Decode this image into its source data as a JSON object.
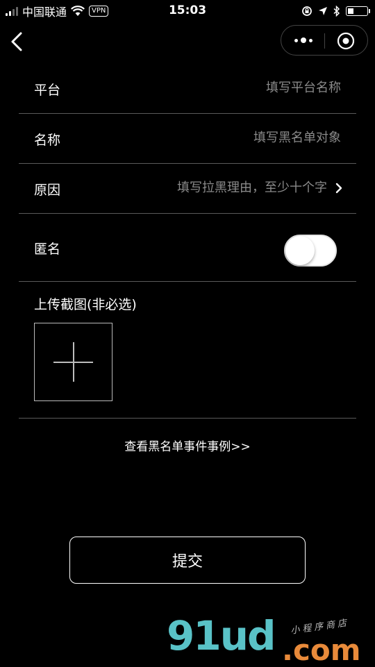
{
  "status_bar": {
    "carrier": "中国联通",
    "vpn": "VPN",
    "time": "15:03"
  },
  "form": {
    "platform": {
      "label": "平台",
      "placeholder": "填写平台名称"
    },
    "name": {
      "label": "名称",
      "placeholder": "填写黑名单对象"
    },
    "reason": {
      "label": "原因",
      "placeholder": "填写拉黑理由，至少十个字"
    },
    "anonymous": {
      "label": "匿名",
      "enabled": false
    }
  },
  "upload": {
    "title": "上传截图(非必选)"
  },
  "example_link": "查看黑名单事件事例>>",
  "submit_label": "提交",
  "watermark": {
    "logo": "91ud",
    "domain": ".com",
    "tagline": "小程序商店"
  },
  "colors": {
    "background": "#000000",
    "placeholder": "#8a8a8a",
    "divider": "#5a5a5a",
    "watermark_teal": "#59c2c7",
    "watermark_orange": "#e88a3a"
  }
}
